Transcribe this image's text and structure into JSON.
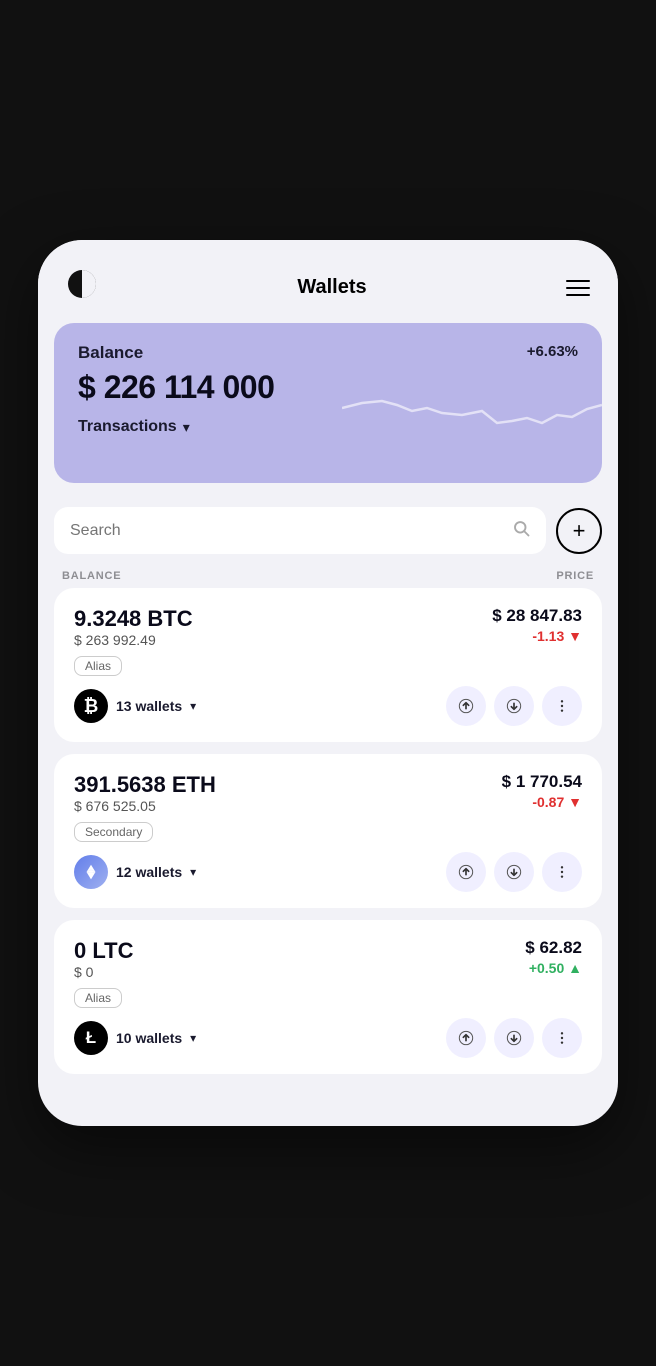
{
  "header": {
    "title": "Wallets",
    "logo_symbol": "◑",
    "menu_label": "menu"
  },
  "balance_card": {
    "label": "Balance",
    "percent": "+6.63%",
    "amount": "$ 226 114 000",
    "transactions_label": "Transactions"
  },
  "search": {
    "placeholder": "Search",
    "add_label": "+"
  },
  "columns": {
    "balance": "BALANCE",
    "price": "PRICE"
  },
  "coins": [
    {
      "id": "btc",
      "amount": "9.3248 BTC",
      "usd_value": "$ 263 992.49",
      "alias": "Alias",
      "wallets_count": "13 wallets",
      "price": "$ 28 847.83",
      "change": "-1.13",
      "change_type": "negative",
      "logo_symbol": "₿",
      "logo_class": "btc"
    },
    {
      "id": "eth",
      "amount": "391.5638 ETH",
      "usd_value": "$ 676 525.05",
      "alias": "Secondary",
      "wallets_count": "12 wallets",
      "price": "$ 1 770.54",
      "change": "-0.87",
      "change_type": "negative",
      "logo_symbol": "⬡",
      "logo_class": "eth"
    },
    {
      "id": "ltc",
      "amount": "0 LTC",
      "usd_value": "$ 0",
      "alias": "Alias",
      "wallets_count": "10 wallets",
      "price": "$ 62.82",
      "change": "+0.50",
      "change_type": "positive",
      "logo_symbol": "Ł",
      "logo_class": "ltc"
    }
  ]
}
